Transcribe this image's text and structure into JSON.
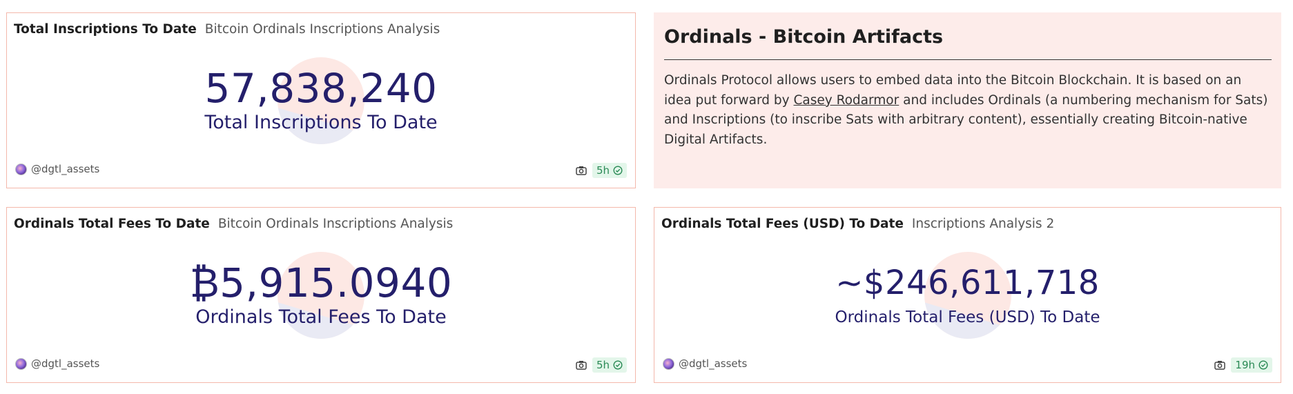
{
  "cards": [
    {
      "title": "Total Inscriptions To Date",
      "subtitle": "Bitcoin Ordinals Inscriptions Analysis",
      "value": "57,838,240",
      "value_label": "Total Inscriptions To Date",
      "author": "@dgtl_assets",
      "age": "5h"
    },
    {
      "title": "Ordinals Total Fees To Date",
      "subtitle": "Bitcoin Ordinals Inscriptions Analysis",
      "value": "₿5,915.0940",
      "value_label": "Ordinals Total Fees To Date",
      "author": "@dgtl_assets",
      "age": "5h"
    },
    {
      "title": "Ordinals Total Fees (USD) To Date",
      "subtitle": "Inscriptions Analysis 2",
      "value": "~$246,611,718",
      "value_label": "Ordinals Total Fees (USD) To Date",
      "author": "@dgtl_assets",
      "age": "19h"
    }
  ],
  "text_card": {
    "title": "Ordinals - Bitcoin Artifacts",
    "body_1": "Ordinals Protocol allows users to embed data into the Bitcoin Blockchain. It is based on an idea put forward by",
    "link": "Casey Rodarmor",
    "body_2": "and includes Ordinals (a numbering mechanism for Sats) and Inscriptions (to inscribe Sats with arbitrary content), essentially creating Bitcoin-native Digital Artifacts."
  },
  "icons": {
    "snapshot": "camera-icon",
    "fresh": "check-circle-icon",
    "avatar": "avatar"
  },
  "colors": {
    "card_border": "#f4b8ab",
    "value_text": "#241f6b",
    "text_card_bg": "#fdecea",
    "badge_bg": "#e3f6ea",
    "badge_text": "#2a8a55"
  }
}
